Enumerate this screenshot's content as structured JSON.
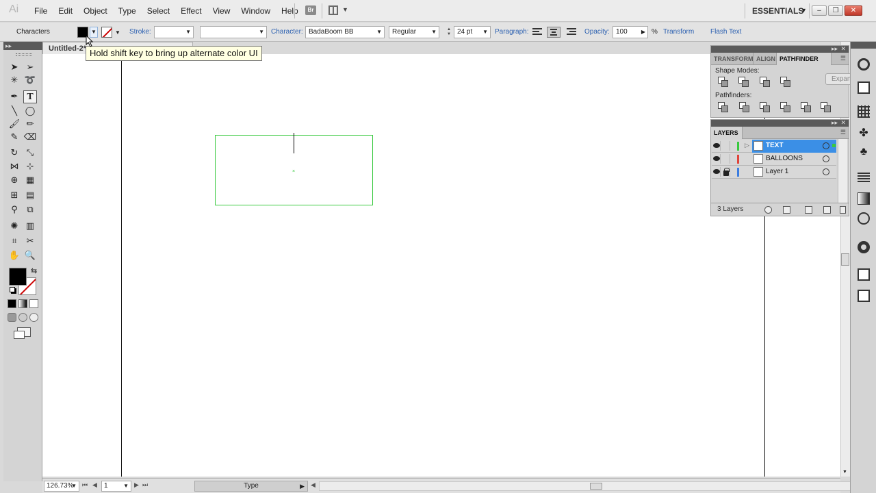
{
  "app": {
    "logo": "Ai",
    "workspace": "ESSENTIALS",
    "bridge_label": "Br"
  },
  "menu": [
    "File",
    "Edit",
    "Object",
    "Type",
    "Select",
    "Effect",
    "View",
    "Window",
    "Help"
  ],
  "controlbar": {
    "selection_label": "Characters",
    "stroke_label": "Stroke:",
    "character_label": "Character:",
    "font_family": "BadaBoom BB",
    "font_style": "Regular",
    "font_size": "24 pt",
    "paragraph_label": "Paragraph:",
    "opacity_label": "Opacity:",
    "opacity_value": "100",
    "opacity_unit": "%",
    "transform_link": "Transform",
    "flash_text_link": "Flash Text",
    "fill_color": "#000000"
  },
  "tooltip": "Hold shift key to bring up alternate color UI",
  "document": {
    "tab_title": "Untitled-2*"
  },
  "statusbar": {
    "zoom": "126.73%",
    "artboard": "1",
    "status": "Type"
  },
  "panels": {
    "pathfinder": {
      "tabs": [
        "TRANSFORM",
        "ALIGN",
        "PATHFINDER"
      ],
      "active_tab": "PATHFINDER",
      "shape_modes_label": "Shape Modes:",
      "pathfinders_label": "Pathfinders:",
      "expand_label": "Expand"
    },
    "layers": {
      "tab": "LAYERS",
      "rows": [
        {
          "name": "TEXT",
          "color": "#39c93f",
          "locked": false,
          "selected": true
        },
        {
          "name": "BALLOONS",
          "color": "#e0443a",
          "locked": false,
          "selected": false
        },
        {
          "name": "Layer 1",
          "color": "#3b7de0",
          "locked": true,
          "selected": false
        }
      ],
      "count": "3 Layers"
    }
  },
  "colors": {
    "selection": "#39c93f",
    "link": "#2a5fb0",
    "layer_highlight": "#3b8fe6"
  }
}
